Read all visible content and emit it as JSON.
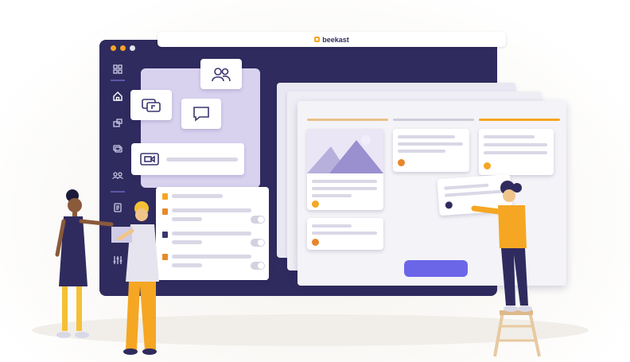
{
  "browser": {
    "brand": "beekast",
    "logo_color": "#f5a623"
  },
  "colors": {
    "window": "#2f2b5e",
    "accent_orange": "#f5a623",
    "accent_purple": "#6b66e8",
    "panel_lavender": "#d9d2ef"
  },
  "sidebar": {
    "items": [
      {
        "icon": "grid-icon"
      },
      {
        "icon": "home-icon"
      },
      {
        "icon": "present-icon"
      },
      {
        "icon": "slides-icon"
      },
      {
        "icon": "participants-icon"
      },
      {
        "icon": "document-icon"
      },
      {
        "icon": "settings-sliders-icon"
      }
    ]
  },
  "panel_icons": [
    "participants-icon",
    "screen-share-icon",
    "comment-icon",
    "video-icon"
  ],
  "illustration": {
    "people": [
      "woman-pointing",
      "person-with-laptop",
      "woman-on-ladder"
    ]
  }
}
